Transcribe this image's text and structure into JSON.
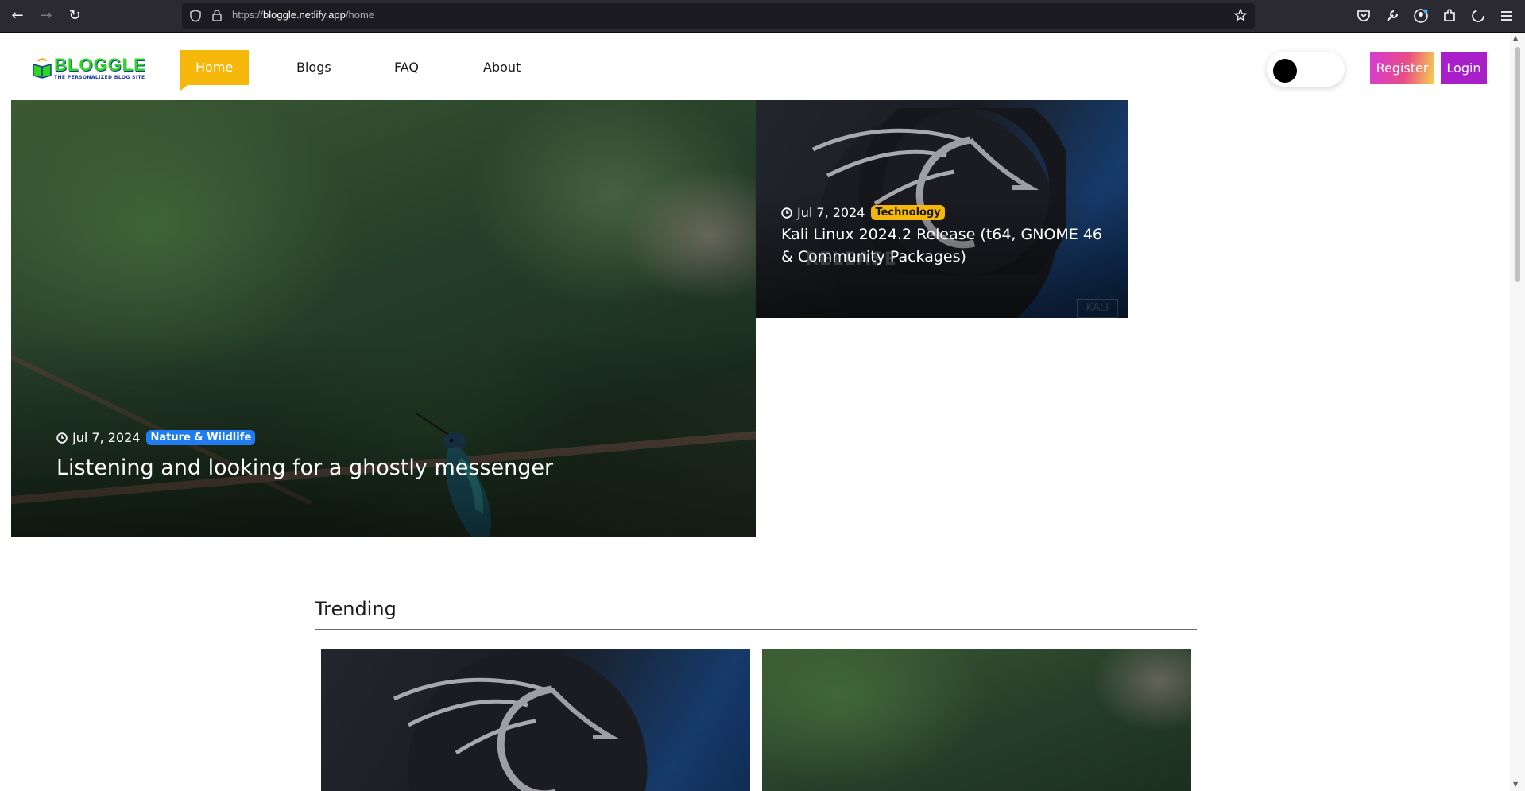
{
  "browser": {
    "url_scheme": "https://",
    "url_host": "bloggle.netlify.app",
    "url_path": "/home"
  },
  "site": {
    "logo_name": "BLOGGLE",
    "logo_tagline": "THE PERSONALIZED BLOG SITE",
    "nav": [
      {
        "label": "Home",
        "active": true
      },
      {
        "label": "Blogs",
        "active": false
      },
      {
        "label": "FAQ",
        "active": false
      },
      {
        "label": "About",
        "active": false
      }
    ],
    "register_label": "Register",
    "login_label": "Login",
    "theme_toggle": "dark-mode-toggle"
  },
  "featured": [
    {
      "date": "Jul 7, 2024",
      "category": "Nature & Wildlife",
      "title": "Listening and looking for a ghostly messenger",
      "category_color": "#1f7df0"
    },
    {
      "date": "Jul 7, 2024",
      "category": "Technology",
      "title": "Kali Linux 2024.2 Release (t64, GNOME 46 & Community Packages)",
      "category_color": "#f5b80a"
    }
  ],
  "trending": {
    "heading": "Trending"
  },
  "colors": {
    "accent": "#f5b80a",
    "login": "#a81ec9"
  }
}
